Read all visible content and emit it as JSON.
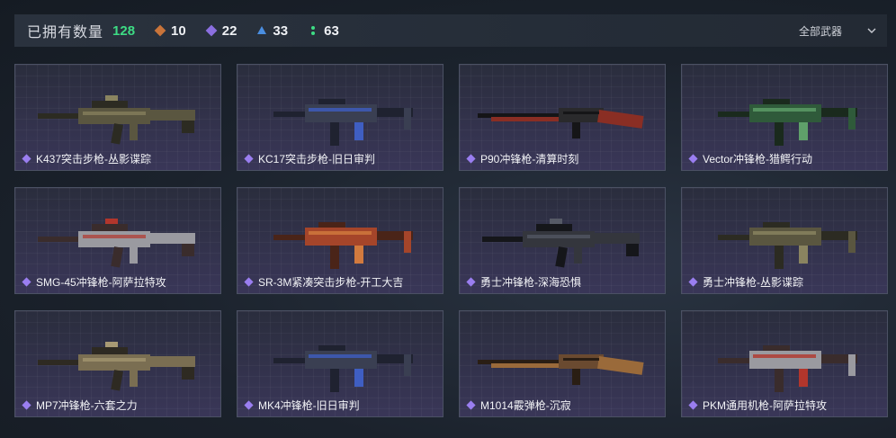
{
  "header": {
    "title": "已拥有数量",
    "total": "128",
    "stats": [
      {
        "icon": "orange-rarity-icon",
        "value": "10",
        "color": "#c9743a"
      },
      {
        "icon": "purple-rarity-icon",
        "value": "22",
        "color": "#8b6fe0"
      },
      {
        "icon": "blue-rarity-icon",
        "value": "33",
        "color": "#4a8ee0"
      },
      {
        "icon": "green-rarity-icon",
        "value": "63",
        "color": "#3ddc84"
      }
    ],
    "filter_label": "全部武器"
  },
  "weapons": [
    {
      "label": "K437突击步枪-丛影谍踪",
      "tone": "camo"
    },
    {
      "label": "KC17突击步枪-旧日审判",
      "tone": "blue"
    },
    {
      "label": "P90冲锋枪-清算时刻",
      "tone": "red"
    },
    {
      "label": "Vector冲锋枪-猎鳄行动",
      "tone": "green"
    },
    {
      "label": "SMG-45冲锋枪-阿萨拉特攻",
      "tone": "redwhite"
    },
    {
      "label": "SR-3M紧凑突击步枪-开工大吉",
      "tone": "orange"
    },
    {
      "label": "勇士冲锋枪-深海恐惧",
      "tone": "dark"
    },
    {
      "label": "勇士冲锋枪-丛影谍踪",
      "tone": "camo"
    },
    {
      "label": "MP7冲锋枪-六套之力",
      "tone": "sand"
    },
    {
      "label": "MK4冲锋枪-旧日审判",
      "tone": "blue"
    },
    {
      "label": "M1014霰弹枪-沉寂",
      "tone": "wood"
    },
    {
      "label": "PKM通用机枪-阿萨拉特攻",
      "tone": "redwhite"
    }
  ],
  "colors": {
    "rarity_purple": "#9a7ef0",
    "total_green": "#3ddc84"
  }
}
